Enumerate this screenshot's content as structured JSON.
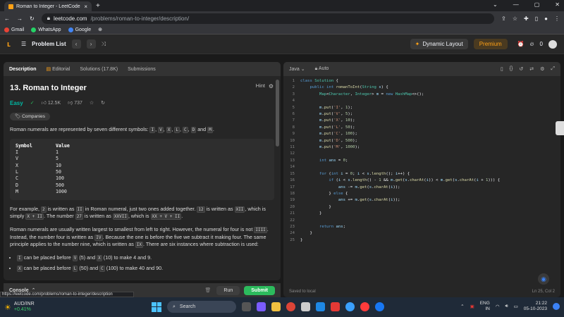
{
  "browser": {
    "tab_title": "Roman to Integer - LeetCode",
    "url_host": "leetcode.com",
    "url_path": "/problems/roman-to-integer/description/"
  },
  "bookmarks": [
    "Gmail",
    "WhatsApp",
    "Google"
  ],
  "lc": {
    "problem_list": "Problem List",
    "dynamic_layout": "Dynamic Layout",
    "premium": "Premium",
    "streak": "0"
  },
  "tabs": {
    "description": "Description",
    "editorial": "Editorial",
    "solutions": "Solutions (17.8K)",
    "submissions": "Submissions"
  },
  "problem": {
    "title": "13. Roman to Integer",
    "hint": "Hint",
    "difficulty": "Easy",
    "likes": "12.5K",
    "dislikes": "737",
    "companies": "Companies",
    "intro1": "Roman numerals are represented by seven different symbols:",
    "intro2": "and",
    "symbols": [
      "I",
      "V",
      "X",
      "L",
      "C",
      "D",
      "M"
    ],
    "table_head": [
      "Symbol",
      "Value"
    ],
    "table": [
      [
        "I",
        "1"
      ],
      [
        "V",
        "5"
      ],
      [
        "X",
        "10"
      ],
      [
        "L",
        "50"
      ],
      [
        "C",
        "100"
      ],
      [
        "D",
        "500"
      ],
      [
        "M",
        "1000"
      ]
    ],
    "p2": [
      "For example,",
      "2",
      "is written as",
      "II",
      "in Roman numeral, just two ones added together.",
      "12",
      "is written as",
      "XII",
      ", which is simply",
      "X + II",
      ". The number",
      "27",
      "is written as",
      "XXVII",
      ", which is",
      "XX + V + II",
      "."
    ],
    "p3": [
      "Roman numerals are usually written largest to smallest from left to right. However, the numeral for four is not",
      "IIII",
      ". Instead, the number four is written as",
      "IV",
      ". Because the one is before the five we subtract it making four. The same principle applies to the number nine, which is written as",
      "IX",
      ". There are six instances where subtraction is used:"
    ],
    "bullet1": [
      "I",
      "can be placed before",
      "V",
      "(5) and",
      "X",
      "(10) to make 4 and 9."
    ],
    "bullet2": [
      "X",
      "can be placed before",
      "L",
      "(50) and",
      "C",
      "(100) to make 40 and 90."
    ]
  },
  "console": {
    "label": "Console",
    "run": "Run",
    "submit": "Submit"
  },
  "editor": {
    "language": "Java",
    "mode": "Auto",
    "saved": "Saved to local",
    "cursor": "Ln 25, Col 2"
  },
  "status_url": "https://leetcode.com/problems/roman-to-integer/description",
  "taskbar": {
    "ticker": "AUD/INR",
    "change": "+0.41%",
    "search": "Search",
    "lang1": "ENG",
    "lang2": "IN",
    "time": "21:22",
    "date": "05-10-2023"
  }
}
